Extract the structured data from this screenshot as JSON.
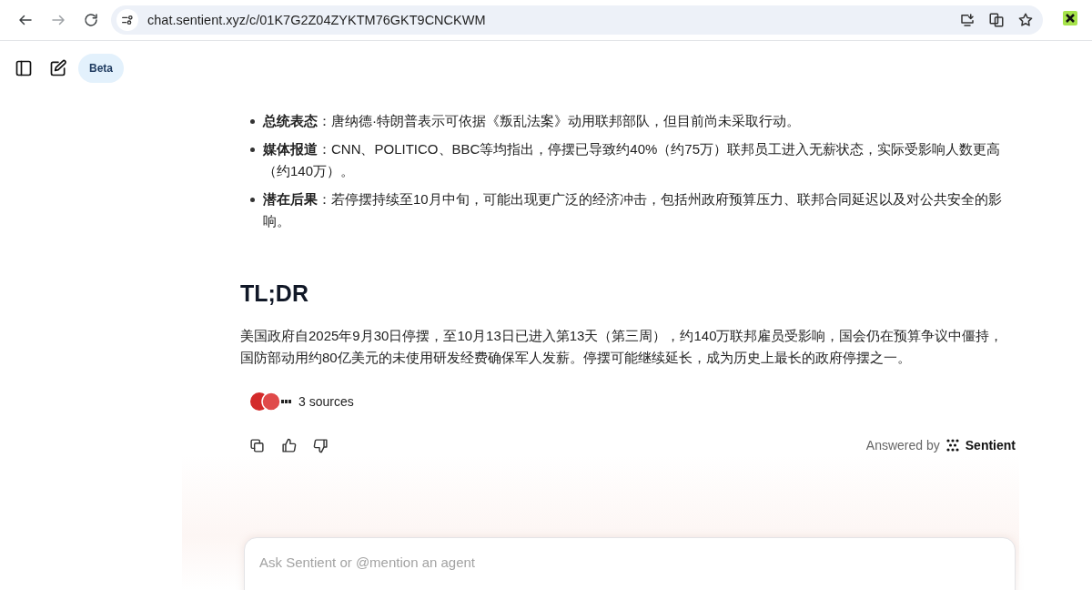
{
  "browser": {
    "url": "chat.sentient.xyz/c/01K7G2Z04ZYKTM76GKT9CNCKWM"
  },
  "header": {
    "badge": "Beta"
  },
  "bullets": [
    "**总统表态**：唐纳德·特朗普表示可依据《叛乱法案》动用联邦部队，但目前尚未采取行动。",
    "**媒体报道**：CNN、POLITICO、BBC等均指出，停摆已导致约40%（约75万）联邦员工进入无薪状态，实际受影响人数更高（约140万）。",
    "**潜在后果**：若停摆持续至10月中旬，可能出现更广泛的经济冲击，包括州政府预算压力、联邦合同延迟以及对公共安全的影响。"
  ],
  "heading": "TL;DR",
  "summary": "美国政府自2025年9月30日停摆，至10月13日已进入第13天（第三周），约140万联邦雇员受影响，国会仍在预算争议中僵持，国防部动用约80亿美元的未使用研发经费确保军人发薪。停摆可能继续延长，成为历史上最长的政府停摆之一。",
  "sources": {
    "label": "3 sources"
  },
  "answered_by": {
    "label": "Answered by",
    "brand": "Sentient"
  },
  "composer": {
    "placeholder": "Ask Sentient or @mention an agent"
  }
}
